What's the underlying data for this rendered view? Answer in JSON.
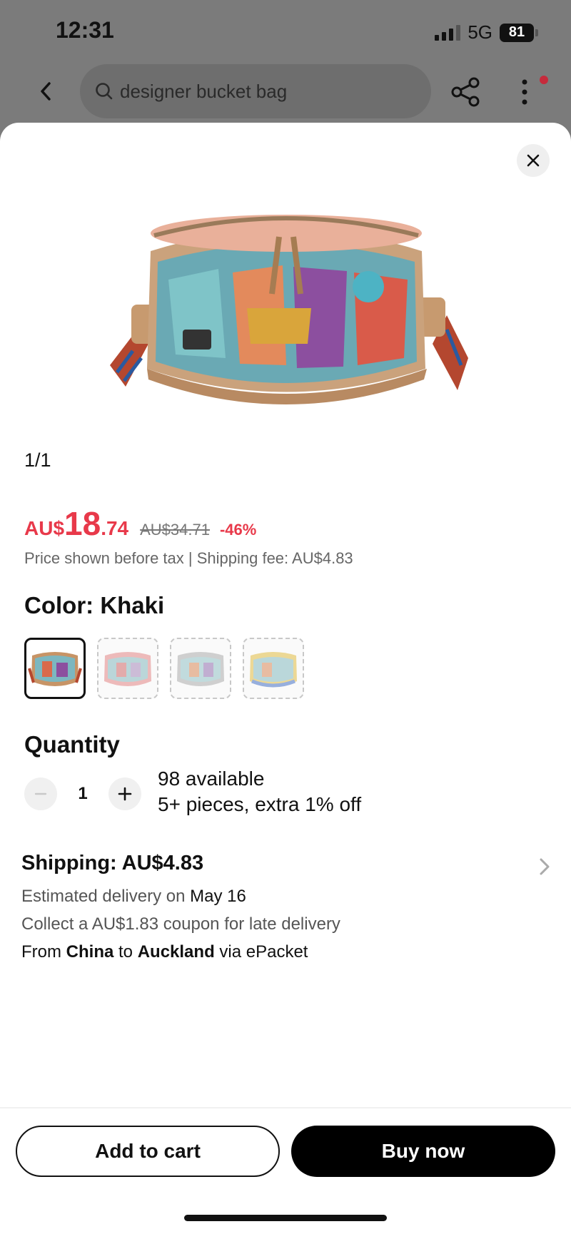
{
  "status": {
    "time": "12:31",
    "network": "5G",
    "battery": "81"
  },
  "search": {
    "query": "designer bucket bag"
  },
  "gallery": {
    "counter": "1/1"
  },
  "price": {
    "currency": "AU$",
    "integer": "18",
    "decimal": ".74",
    "original": "AU$34.71",
    "discount": "-46%",
    "note": "Price shown before tax | Shipping fee: AU$4.83"
  },
  "color": {
    "title": "Color: Khaki",
    "options": [
      "Khaki",
      "Pink",
      "Silver",
      "Blue"
    ],
    "selected_index": 0
  },
  "quantity": {
    "title": "Quantity",
    "value": "1",
    "available": "98 available",
    "promo": "5+ pieces, extra 1% off"
  },
  "shipping": {
    "title": "Shipping: AU$4.83",
    "delivery_prefix": "Estimated delivery on ",
    "delivery_date": "May 16",
    "coupon": "Collect a AU$1.83 coupon for late delivery",
    "from_label": "From ",
    "origin": "China",
    "to_label": " to ",
    "destination": "Auckland",
    "via": " via ePacket"
  },
  "actions": {
    "add_to_cart": "Add to cart",
    "buy_now": "Buy now"
  },
  "colors": {
    "accent": "#e8394a",
    "primary_button": "#000000"
  }
}
